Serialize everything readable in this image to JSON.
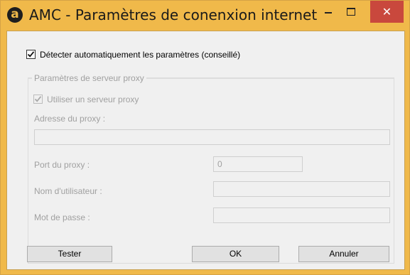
{
  "window": {
    "title": "AMC - Paramètres de conenxion internet",
    "app_icon_glyph": "a",
    "close_glyph": "✕"
  },
  "auto_detect": {
    "label": "Détecter automatiquement les paramètres (conseillé)",
    "checked": true
  },
  "proxy_group": {
    "legend": "Paramètres de serveur proxy",
    "use_proxy": {
      "label": "Utiliser un serveur proxy",
      "checked": true,
      "enabled": false
    },
    "address_label": "Adresse du proxy :",
    "address_value": "",
    "port_label": "Port du proxy :",
    "port_value": "0",
    "username_label": "Nom d'utilisateur :",
    "username_value": "",
    "password_label": "Mot de passe :",
    "password_value": ""
  },
  "buttons": {
    "test": "Tester",
    "ok": "OK",
    "cancel": "Annuler"
  },
  "colors": {
    "titlebar": "#f0b94a",
    "close_button": "#c9483d",
    "disabled_text": "#a0a0a0"
  }
}
